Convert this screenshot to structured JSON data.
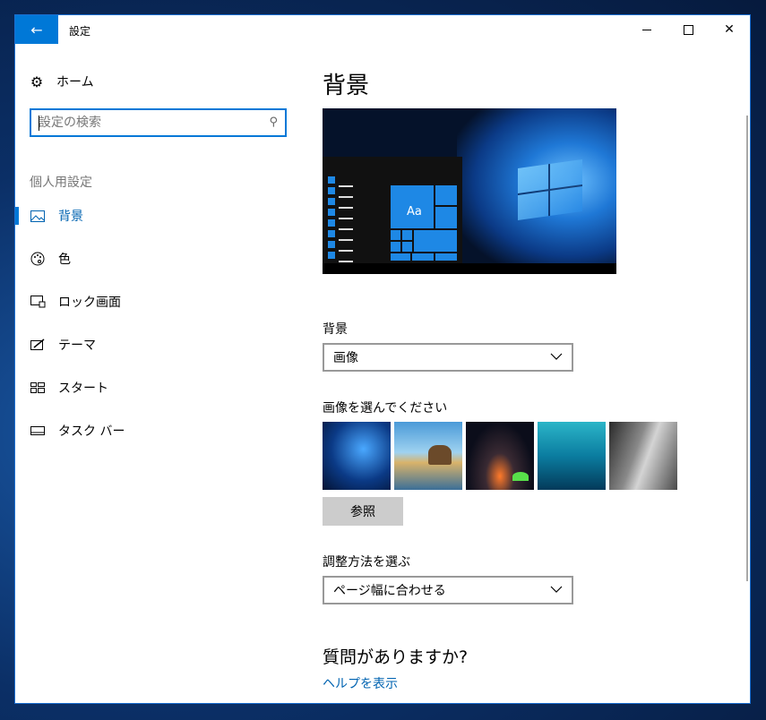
{
  "window": {
    "title": "設定",
    "back_icon": "←",
    "minimize_icon": "minimize-icon",
    "maximize_icon": "maximize-icon",
    "close_icon": "✕"
  },
  "sidebar": {
    "home_label": "ホーム",
    "search_placeholder": "設定の検索",
    "section_title": "個人用設定",
    "items": [
      {
        "label": "背景",
        "icon": "picture-icon",
        "active": true
      },
      {
        "label": "色",
        "icon": "palette-icon",
        "active": false
      },
      {
        "label": "ロック画面",
        "icon": "lock-screen-icon",
        "active": false
      },
      {
        "label": "テーマ",
        "icon": "theme-icon",
        "active": false
      },
      {
        "label": "スタート",
        "icon": "start-icon",
        "active": false
      },
      {
        "label": "タスク バー",
        "icon": "taskbar-icon",
        "active": false
      }
    ]
  },
  "main": {
    "title": "背景",
    "preview": {
      "tile_label": "Aa"
    },
    "background_label": "背景",
    "background_value": "画像",
    "choose_picture_label": "画像を選んでください",
    "browse_label": "参照",
    "fit_label": "調整方法を選ぶ",
    "fit_value": "ページ幅に合わせる",
    "question_title": "質問がありますか?",
    "help_link": "ヘルプを表示"
  },
  "colors": {
    "accent": "#0078d7",
    "link": "#0063b1"
  }
}
